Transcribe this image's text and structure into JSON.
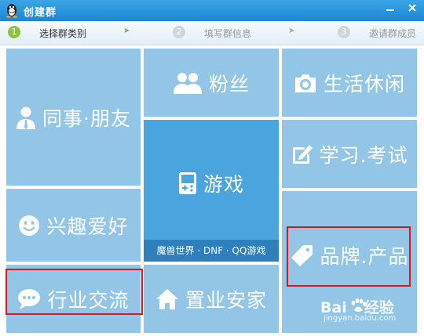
{
  "window": {
    "title": "创建群"
  },
  "steps": [
    {
      "num": "1",
      "label": "选择群类别"
    },
    {
      "num": "2",
      "label": "填写群信息"
    },
    {
      "num": "3",
      "label": "邀请群成员"
    }
  ],
  "arrow_glyph": "➤",
  "tiles": {
    "colleague_friend": "同事·朋友",
    "fans": "粉丝",
    "life_leisure": "生活休闲",
    "games": "游戏",
    "games_sub": "魔兽世界 · DNF · QQ游戏",
    "study_exam": "学习.考试",
    "hobbies": "兴趣爱好",
    "brand_product": "品牌.产品",
    "industry": "行业交流",
    "real_estate": "置业安家"
  },
  "watermark": {
    "brand_a": "Bai",
    "brand_b": "经验",
    "url": "jingyan.baidu.com"
  },
  "colors": {
    "tile": "#92c5e6",
    "featured_tile": "#4aa5de",
    "highlight": "#e0141e",
    "titlebar": "#1b86d3"
  }
}
